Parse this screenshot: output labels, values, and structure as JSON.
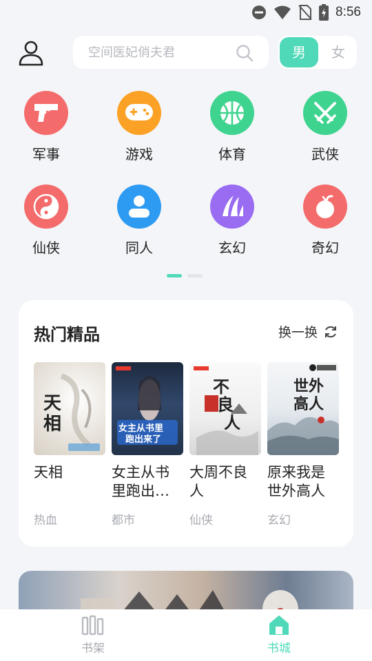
{
  "status_bar": {
    "time": "8:56"
  },
  "header": {
    "search": {
      "placeholder": "空间医妃俏夫君"
    },
    "gender": {
      "male": "男",
      "female": "女",
      "selected": "男"
    }
  },
  "categories": [
    {
      "label": "军事",
      "icon": "gun-icon",
      "color": "#f46b6b"
    },
    {
      "label": "游戏",
      "icon": "gamepad-icon",
      "color": "#fba125"
    },
    {
      "label": "体育",
      "icon": "basketball-icon",
      "color": "#3ed38f"
    },
    {
      "label": "武侠",
      "icon": "crossed-swords-icon",
      "color": "#3ed38f"
    },
    {
      "label": "仙侠",
      "icon": "yin-yang-icon",
      "color": "#f46b6b"
    },
    {
      "label": "同人",
      "icon": "person-icon",
      "color": "#2e9bf2"
    },
    {
      "label": "玄幻",
      "icon": "claw-icon",
      "color": "#9a6cf2"
    },
    {
      "label": "奇幻",
      "icon": "bomb-icon",
      "color": "#f46b6b"
    }
  ],
  "pager": {
    "pages": 2,
    "active": 1
  },
  "hot": {
    "title": "热门精品",
    "refresh_label": "换一换",
    "books": [
      {
        "title": "天相",
        "tag": "热血",
        "cover_text": "天相"
      },
      {
        "title": "女主从书里跑出来了",
        "tag": "都市",
        "cover_text": "女主从书里跑出来了"
      },
      {
        "title": "大周不良人",
        "tag": "仙侠",
        "cover_text": "不良人"
      },
      {
        "title": "原来我是世外高人",
        "tag": "玄幻",
        "cover_text": "世外高人"
      }
    ]
  },
  "nav": {
    "bookshelf": "书架",
    "bookstore": "书城",
    "active": "书城",
    "accent": "#4fd9b8"
  }
}
